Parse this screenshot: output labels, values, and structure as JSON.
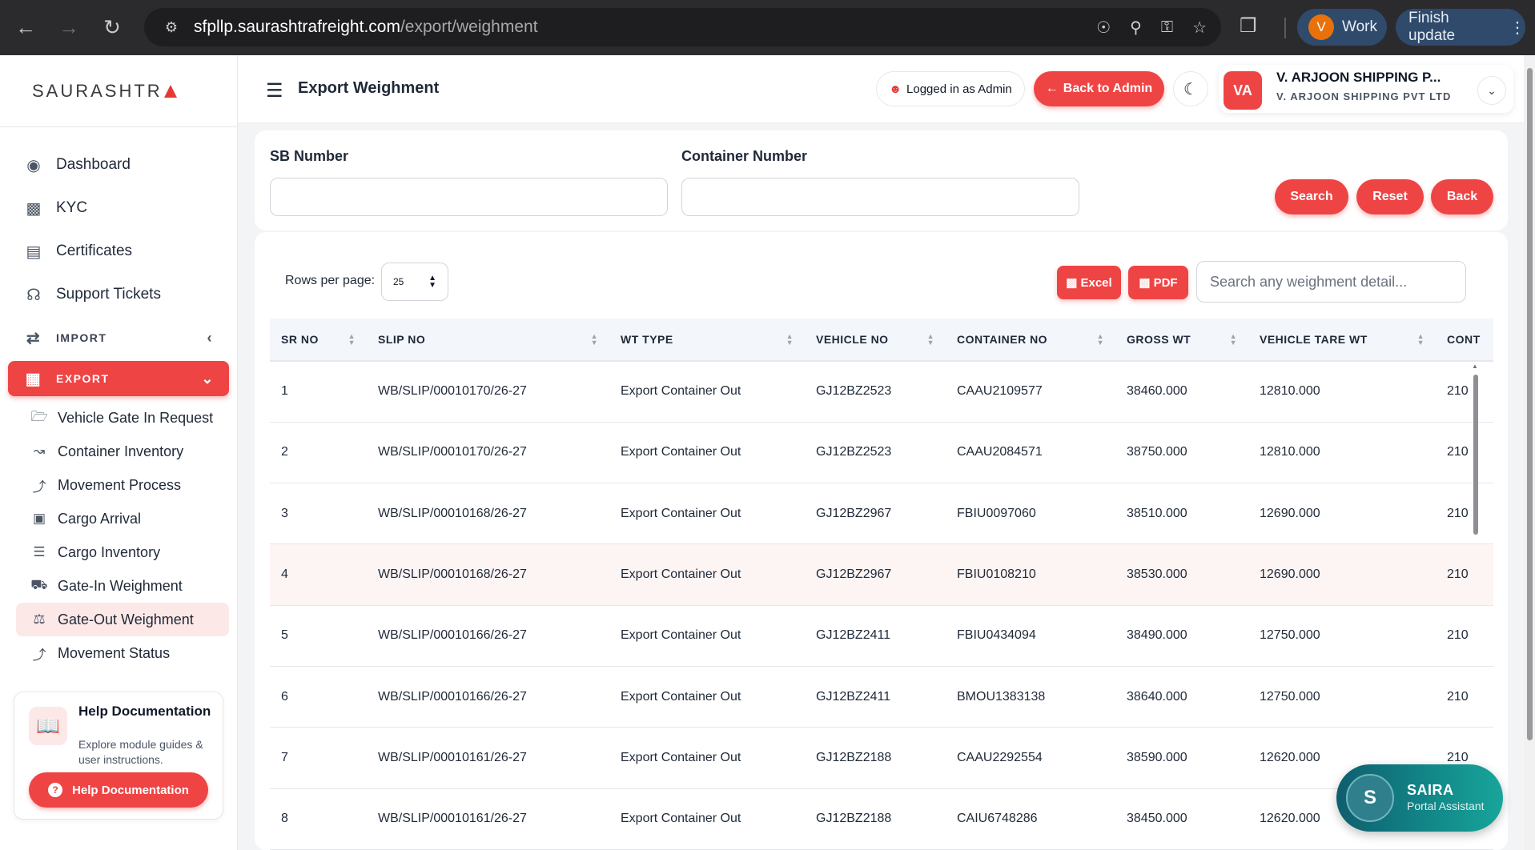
{
  "browser": {
    "url_host": "sfpllp.saurashtrafreight.com",
    "url_path": "/export/weighment",
    "profile_initial": "V",
    "profile_label": "Work",
    "update_label": "Finish update"
  },
  "sidebar": {
    "logo_text": "SAURASHTR",
    "menu": [
      {
        "label": "Dashboard",
        "icon": "palette-icon"
      },
      {
        "label": "KYC",
        "icon": "id-card-icon"
      },
      {
        "label": "Certificates",
        "icon": "file-certificate-icon"
      },
      {
        "label": "Support Tickets",
        "icon": "headset-icon"
      }
    ],
    "import_label": "IMPORT",
    "export_label": "EXPORT",
    "export_items": [
      {
        "label": "Vehicle Gate In Request",
        "icon": "folder-open-icon"
      },
      {
        "label": "Container Inventory",
        "icon": "line-chart-icon"
      },
      {
        "label": "Movement Process",
        "icon": "route-icon"
      },
      {
        "label": "Cargo Arrival",
        "icon": "truck-loading-icon"
      },
      {
        "label": "Cargo Inventory",
        "icon": "warehouse-icon"
      },
      {
        "label": "Gate-In Weighment",
        "icon": "truck-icon"
      },
      {
        "label": "Gate-Out Weighment",
        "icon": "scale-icon"
      },
      {
        "label": "Movement Status",
        "icon": "route-icon"
      }
    ],
    "help": {
      "title": "Help Documentation",
      "description": "Explore module guides & user instructions.",
      "button_label": "Help Documentation"
    }
  },
  "header": {
    "title": "Export Weighment",
    "logged_in_label": "Logged in as Admin",
    "back_admin_label": "Back to Admin",
    "company_initials": "VA",
    "company_name_short": "V. ARJOON SHIPPING P...",
    "company_name_full": "V. ARJOON SHIPPING PVT LTD"
  },
  "filters": {
    "sb_label": "SB Number",
    "sb_value": "",
    "container_label": "Container Number",
    "container_value": "",
    "search_label": "Search",
    "reset_label": "Reset",
    "back_label": "Back"
  },
  "table": {
    "rows_per_page_label": "Rows per page:",
    "rows_per_page_value": "25",
    "excel_label": "Excel",
    "pdf_label": "PDF",
    "search_placeholder": "Search any weighment detail...",
    "columns": [
      "SR NO",
      "SLIP NO",
      "WT TYPE",
      "VEHICLE NO",
      "CONTAINER NO",
      "GROSS WT",
      "VEHICLE TARE WT",
      "CONT"
    ],
    "rows": [
      [
        "1",
        "WB/SLIP/00010170/26-27",
        "Export Container Out",
        "GJ12BZ2523",
        "CAAU2109577",
        "38460.000",
        "12810.000",
        "210"
      ],
      [
        "2",
        "WB/SLIP/00010170/26-27",
        "Export Container Out",
        "GJ12BZ2523",
        "CAAU2084571",
        "38750.000",
        "12810.000",
        "210"
      ],
      [
        "3",
        "WB/SLIP/00010168/26-27",
        "Export Container Out",
        "GJ12BZ2967",
        "FBIU0097060",
        "38510.000",
        "12690.000",
        "210"
      ],
      [
        "4",
        "WB/SLIP/00010168/26-27",
        "Export Container Out",
        "GJ12BZ2967",
        "FBIU0108210",
        "38530.000",
        "12690.000",
        "210"
      ],
      [
        "5",
        "WB/SLIP/00010166/26-27",
        "Export Container Out",
        "GJ12BZ2411",
        "FBIU0434094",
        "38490.000",
        "12750.000",
        "210"
      ],
      [
        "6",
        "WB/SLIP/00010166/26-27",
        "Export Container Out",
        "GJ12BZ2411",
        "BMOU1383138",
        "38640.000",
        "12750.000",
        "210"
      ],
      [
        "7",
        "WB/SLIP/00010161/26-27",
        "Export Container Out",
        "GJ12BZ2188",
        "CAAU2292554",
        "38590.000",
        "12620.000",
        "210"
      ],
      [
        "8",
        "WB/SLIP/00010161/26-27",
        "Export Container Out",
        "GJ12BZ2188",
        "CAIU6748286",
        "38450.000",
        "12620.000",
        ""
      ]
    ]
  },
  "assistant": {
    "initial": "S",
    "name": "SAIRA",
    "subtitle": "Portal Assistant"
  }
}
